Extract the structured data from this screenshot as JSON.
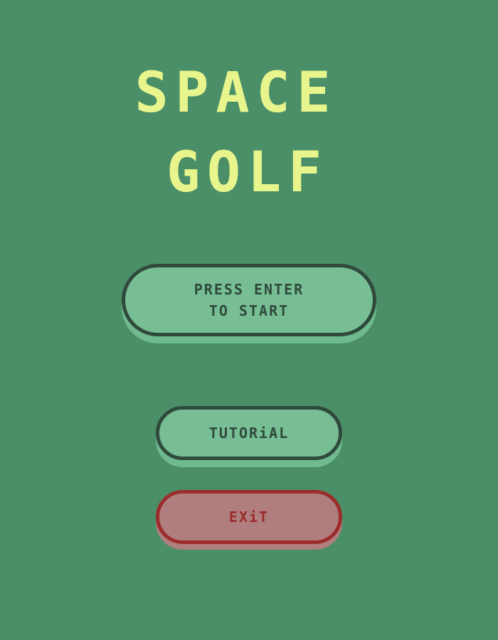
{
  "title": {
    "line1": "SPACE",
    "line2": "GOLF"
  },
  "menu": {
    "start_label": "PRESS ENTER\nTO START",
    "tutorial_label": "TUTORiAL",
    "exit_label": "EXiT"
  },
  "colors": {
    "background": "#4b8f68",
    "title": "#e8f58c",
    "button_fill": "#77be94",
    "button_border": "#2f4a3c",
    "exit_fill": "#b07e7e",
    "exit_border": "#9c2c2c"
  }
}
